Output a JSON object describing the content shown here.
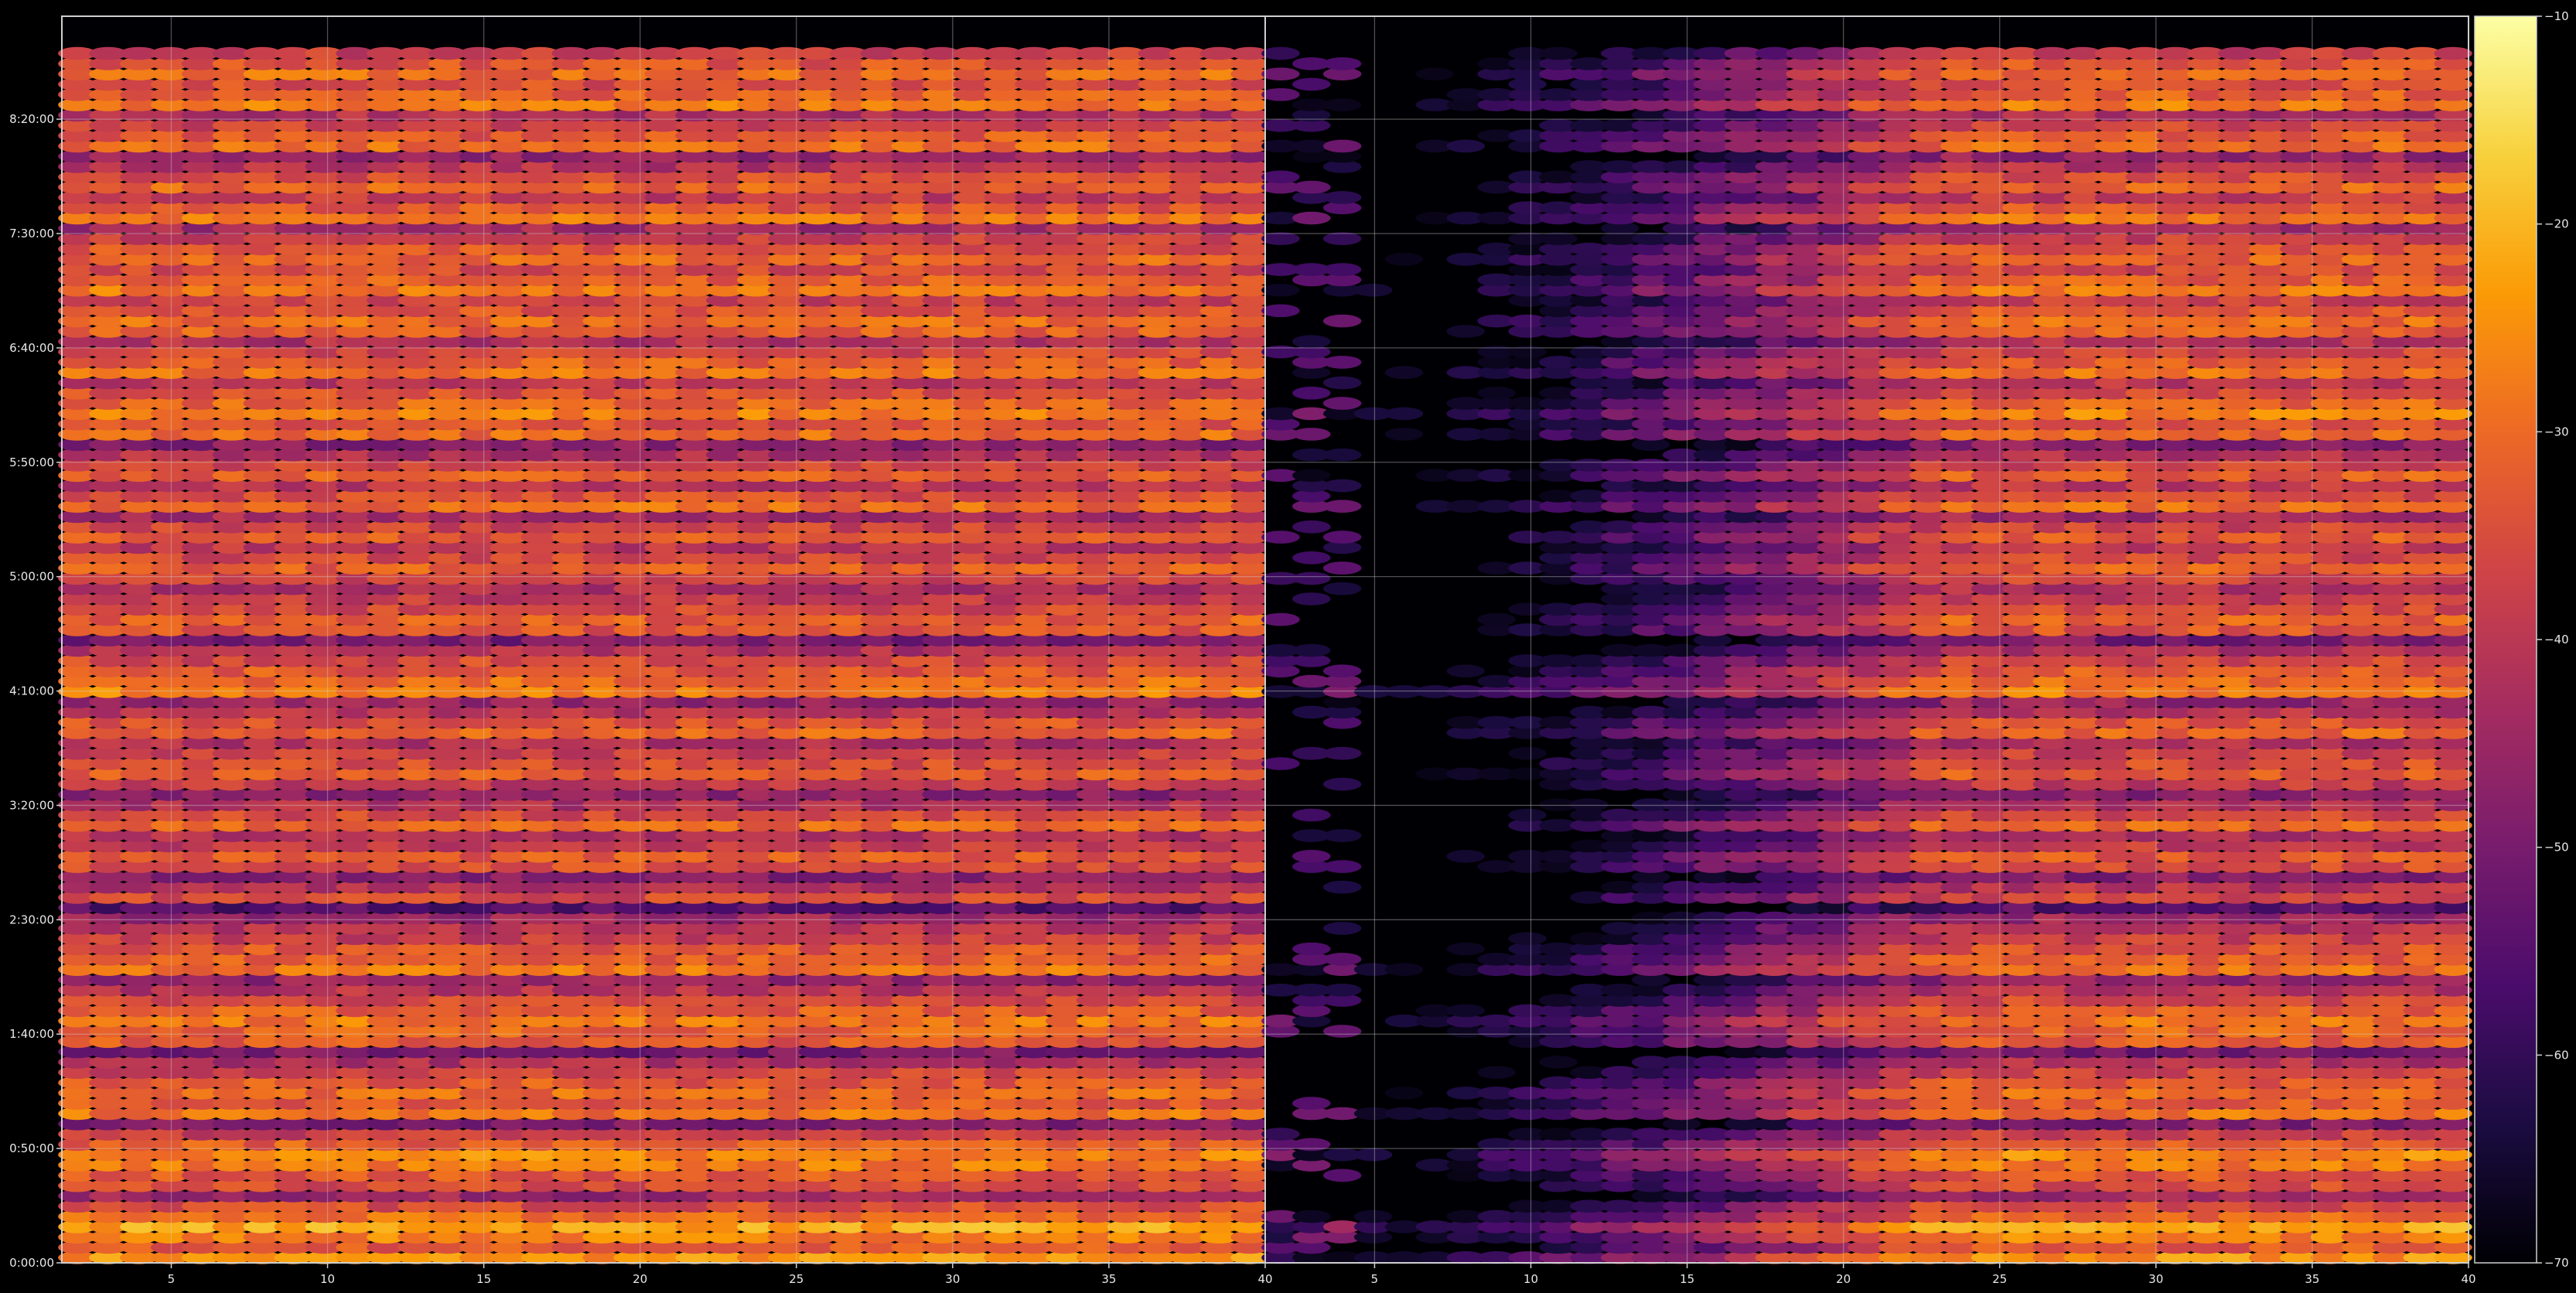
{
  "chart_data": {
    "type": "heatmap",
    "title": "",
    "xlabel": "",
    "ylabel": "",
    "panels": [
      {
        "name": "",
        "xlim": [
          1.5,
          40
        ],
        "x_ticks": [
          5,
          10,
          15,
          20,
          25,
          30,
          35,
          40
        ],
        "x_tick_labels": [
          "5",
          "10",
          "15",
          "20",
          "25",
          "30",
          "35",
          "40"
        ],
        "response": "full"
      },
      {
        "name": "",
        "xlim": [
          1.5,
          40
        ],
        "x_ticks": [
          5,
          10,
          15,
          20,
          25,
          30,
          35,
          40
        ],
        "x_tick_labels": [
          "5",
          "10",
          "15",
          "20",
          "25",
          "30",
          "35",
          "40"
        ],
        "response": "delayed"
      }
    ],
    "y_ticks": [
      {
        "minutes": 0,
        "label": "0:00:00"
      },
      {
        "minutes": 50,
        "label": "0:50:00"
      },
      {
        "minutes": 100,
        "label": "1:40:00"
      },
      {
        "minutes": 150,
        "label": "2:30:00"
      },
      {
        "minutes": 200,
        "label": "3:20:00"
      },
      {
        "minutes": 250,
        "label": "4:10:00"
      },
      {
        "minutes": 300,
        "label": "5:00:00"
      },
      {
        "minutes": 350,
        "label": "5:50:00"
      },
      {
        "minutes": 400,
        "label": "6:40:00"
      },
      {
        "minutes": 450,
        "label": "7:30:00"
      },
      {
        "minutes": 500,
        "label": "8:20:00"
      }
    ],
    "ylim_minutes": [
      0,
      545
    ],
    "row_step_minutes": 4.5,
    "columns": 39,
    "grid": true,
    "colorbar": {
      "min": -70,
      "max": -10,
      "ticks": [
        -10,
        -20,
        -30,
        -40,
        -50,
        -60,
        -70
      ],
      "tick_labels": [
        "−10",
        "−20",
        "−30",
        "−40",
        "−50",
        "−60",
        "−70"
      ],
      "colormap": "inferno",
      "colormap_stops": [
        "#000004",
        "#1b0c41",
        "#4a0c6b",
        "#781c6d",
        "#a52c60",
        "#cf4446",
        "#ed6925",
        "#fb9b06",
        "#f7d13d",
        "#fcffa4"
      ]
    },
    "row_levels_dB": [
      -24.5,
      -33,
      -27,
      -22,
      -30,
      -35,
      -45,
      -36,
      -33,
      -28,
      -26,
      -32,
      -38,
      -49,
      -29,
      -33,
      -30,
      -33,
      -37,
      -42,
      -50,
      -33,
      -31,
      -28,
      -32,
      -36,
      -41,
      -46,
      -29,
      -32,
      -34,
      -38,
      -41,
      -45,
      -55,
      -36,
      -41,
      -48,
      -35,
      -33,
      -39,
      -42,
      -31,
      -36,
      -42,
      -47,
      -39,
      -33,
      -35,
      -38,
      -42,
      -31,
      -34,
      -41,
      -46,
      -27,
      -30,
      -33,
      -36,
      -42,
      -50,
      -34,
      -32,
      -36,
      -39,
      -42,
      -37,
      -32,
      -36,
      -40,
      -33,
      -37,
      -44,
      -30,
      -35,
      -40,
      -32,
      -37,
      -42,
      -48,
      -30,
      -34,
      -27,
      -31,
      -35,
      -40,
      -29,
      -32,
      -36,
      -42,
      -32,
      -30,
      -34,
      -38,
      -28,
      -32,
      -36,
      -31,
      -34,
      -38,
      -44,
      -29,
      -33,
      -39,
      -31,
      -35,
      -41,
      -46,
      -30,
      -33,
      -37,
      -42,
      -28,
      -32,
      -35,
      -30,
      -34,
      -38
    ]
  }
}
